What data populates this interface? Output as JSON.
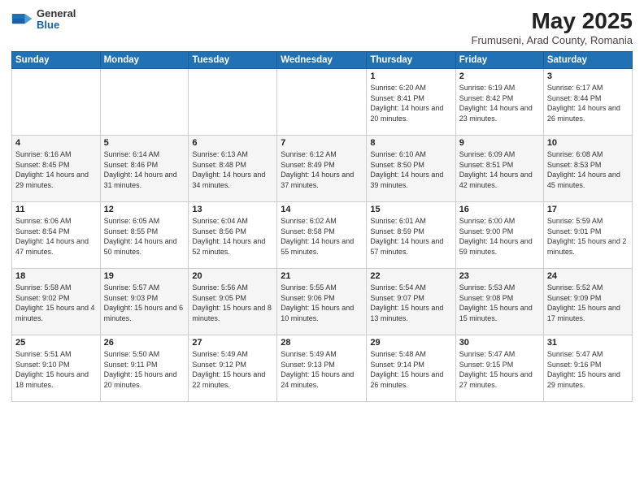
{
  "header": {
    "logo": {
      "general": "General",
      "blue": "Blue"
    },
    "title": "May 2025",
    "location": "Frumuseni, Arad County, Romania"
  },
  "weekdays": [
    "Sunday",
    "Monday",
    "Tuesday",
    "Wednesday",
    "Thursday",
    "Friday",
    "Saturday"
  ],
  "weeks": [
    [
      {
        "day": "",
        "sunrise": "",
        "sunset": "",
        "daylight": ""
      },
      {
        "day": "",
        "sunrise": "",
        "sunset": "",
        "daylight": ""
      },
      {
        "day": "",
        "sunrise": "",
        "sunset": "",
        "daylight": ""
      },
      {
        "day": "",
        "sunrise": "",
        "sunset": "",
        "daylight": ""
      },
      {
        "day": "1",
        "sunrise": "6:20 AM",
        "sunset": "8:41 PM",
        "daylight": "14 hours and 20 minutes."
      },
      {
        "day": "2",
        "sunrise": "6:19 AM",
        "sunset": "8:42 PM",
        "daylight": "14 hours and 23 minutes."
      },
      {
        "day": "3",
        "sunrise": "6:17 AM",
        "sunset": "8:44 PM",
        "daylight": "14 hours and 26 minutes."
      }
    ],
    [
      {
        "day": "4",
        "sunrise": "6:16 AM",
        "sunset": "8:45 PM",
        "daylight": "14 hours and 29 minutes."
      },
      {
        "day": "5",
        "sunrise": "6:14 AM",
        "sunset": "8:46 PM",
        "daylight": "14 hours and 31 minutes."
      },
      {
        "day": "6",
        "sunrise": "6:13 AM",
        "sunset": "8:48 PM",
        "daylight": "14 hours and 34 minutes."
      },
      {
        "day": "7",
        "sunrise": "6:12 AM",
        "sunset": "8:49 PM",
        "daylight": "14 hours and 37 minutes."
      },
      {
        "day": "8",
        "sunrise": "6:10 AM",
        "sunset": "8:50 PM",
        "daylight": "14 hours and 39 minutes."
      },
      {
        "day": "9",
        "sunrise": "6:09 AM",
        "sunset": "8:51 PM",
        "daylight": "14 hours and 42 minutes."
      },
      {
        "day": "10",
        "sunrise": "6:08 AM",
        "sunset": "8:53 PM",
        "daylight": "14 hours and 45 minutes."
      }
    ],
    [
      {
        "day": "11",
        "sunrise": "6:06 AM",
        "sunset": "8:54 PM",
        "daylight": "14 hours and 47 minutes."
      },
      {
        "day": "12",
        "sunrise": "6:05 AM",
        "sunset": "8:55 PM",
        "daylight": "14 hours and 50 minutes."
      },
      {
        "day": "13",
        "sunrise": "6:04 AM",
        "sunset": "8:56 PM",
        "daylight": "14 hours and 52 minutes."
      },
      {
        "day": "14",
        "sunrise": "6:02 AM",
        "sunset": "8:58 PM",
        "daylight": "14 hours and 55 minutes."
      },
      {
        "day": "15",
        "sunrise": "6:01 AM",
        "sunset": "8:59 PM",
        "daylight": "14 hours and 57 minutes."
      },
      {
        "day": "16",
        "sunrise": "6:00 AM",
        "sunset": "9:00 PM",
        "daylight": "14 hours and 59 minutes."
      },
      {
        "day": "17",
        "sunrise": "5:59 AM",
        "sunset": "9:01 PM",
        "daylight": "15 hours and 2 minutes."
      }
    ],
    [
      {
        "day": "18",
        "sunrise": "5:58 AM",
        "sunset": "9:02 PM",
        "daylight": "15 hours and 4 minutes."
      },
      {
        "day": "19",
        "sunrise": "5:57 AM",
        "sunset": "9:03 PM",
        "daylight": "15 hours and 6 minutes."
      },
      {
        "day": "20",
        "sunrise": "5:56 AM",
        "sunset": "9:05 PM",
        "daylight": "15 hours and 8 minutes."
      },
      {
        "day": "21",
        "sunrise": "5:55 AM",
        "sunset": "9:06 PM",
        "daylight": "15 hours and 10 minutes."
      },
      {
        "day": "22",
        "sunrise": "5:54 AM",
        "sunset": "9:07 PM",
        "daylight": "15 hours and 13 minutes."
      },
      {
        "day": "23",
        "sunrise": "5:53 AM",
        "sunset": "9:08 PM",
        "daylight": "15 hours and 15 minutes."
      },
      {
        "day": "24",
        "sunrise": "5:52 AM",
        "sunset": "9:09 PM",
        "daylight": "15 hours and 17 minutes."
      }
    ],
    [
      {
        "day": "25",
        "sunrise": "5:51 AM",
        "sunset": "9:10 PM",
        "daylight": "15 hours and 18 minutes."
      },
      {
        "day": "26",
        "sunrise": "5:50 AM",
        "sunset": "9:11 PM",
        "daylight": "15 hours and 20 minutes."
      },
      {
        "day": "27",
        "sunrise": "5:49 AM",
        "sunset": "9:12 PM",
        "daylight": "15 hours and 22 minutes."
      },
      {
        "day": "28",
        "sunrise": "5:49 AM",
        "sunset": "9:13 PM",
        "daylight": "15 hours and 24 minutes."
      },
      {
        "day": "29",
        "sunrise": "5:48 AM",
        "sunset": "9:14 PM",
        "daylight": "15 hours and 26 minutes."
      },
      {
        "day": "30",
        "sunrise": "5:47 AM",
        "sunset": "9:15 PM",
        "daylight": "15 hours and 27 minutes."
      },
      {
        "day": "31",
        "sunrise": "5:47 AM",
        "sunset": "9:16 PM",
        "daylight": "15 hours and 29 minutes."
      }
    ]
  ],
  "labels": {
    "sunrise": "Sunrise:",
    "sunset": "Sunset:",
    "daylight": "Daylight:"
  }
}
